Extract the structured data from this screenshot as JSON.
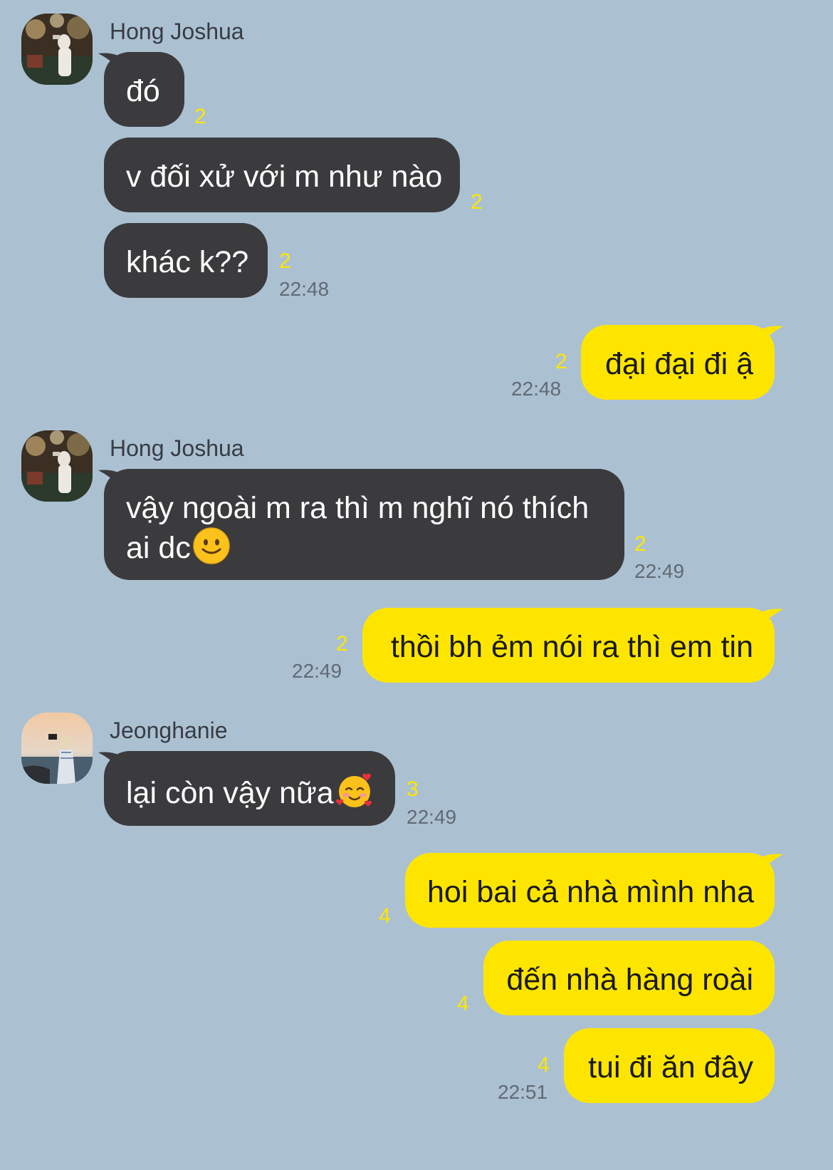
{
  "messages": [
    {
      "sender": "Hong Joshua",
      "text": "đó",
      "count": "2"
    },
    {
      "text": "v đối xử với m như nào",
      "count": "2"
    },
    {
      "text": "khác k??",
      "count": "2",
      "time": "22:48"
    },
    {
      "text": "đại đại đi ậ",
      "count": "2",
      "time": "22:48"
    },
    {
      "sender": "Hong Joshua",
      "line1": "vậy ngoài m ra thì m nghĩ nó thích",
      "line2": "ai dc",
      "emoji": "slightly-smiling-face-icon",
      "count": "2",
      "time": "22:49"
    },
    {
      "text": "thồi bh ẻm nói ra thì em tin",
      "count": "2",
      "time": "22:49"
    },
    {
      "sender": "Jeonghanie",
      "text": "lại còn vậy nữa",
      "emoji": "smiling-face-with-hearts-icon",
      "count": "3",
      "time": "22:49"
    },
    {
      "text": "hoi bai cả nhà mình nha",
      "count": "4"
    },
    {
      "text": "đến nhà hàng roài",
      "count": "4"
    },
    {
      "text": "tui đi ăn đây",
      "count": "4",
      "time": "22:51"
    }
  ],
  "colors": {
    "background": "#abc1d2",
    "incoming_bubble": "#3b3a3d",
    "outgoing_bubble": "#fee500",
    "unread_count": "#fee500",
    "timestamp": "#5f6a75"
  }
}
